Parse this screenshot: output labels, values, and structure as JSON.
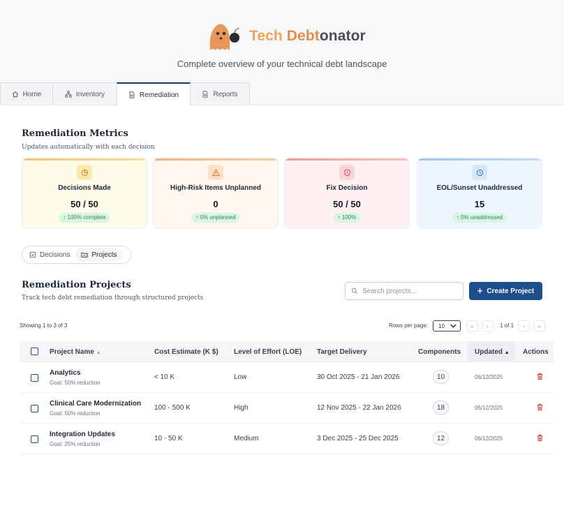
{
  "app": {
    "title_part1": "Tech",
    "title_part2": " Debt",
    "title_part3": "onator",
    "tagline": "Complete overview of your technical debt landscape"
  },
  "tabs": [
    {
      "label": "Home",
      "icon": "home-icon"
    },
    {
      "label": "Inventory",
      "icon": "network-icon"
    },
    {
      "label": "Remediation",
      "icon": "document-icon",
      "active": true
    },
    {
      "label": "Reports",
      "icon": "report-icon"
    }
  ],
  "metrics_section": {
    "title": "Remediation Metrics",
    "subtitle": "Updates automatically with each decision"
  },
  "metrics": [
    {
      "label": "Decisions Made",
      "value": "50 / 50",
      "pill": "↑ 100% complete",
      "icon": "pie-chart-icon",
      "accent": "#f6c56b"
    },
    {
      "label": "High-Risk Items Unplanned",
      "value": "0",
      "pill": "↑ 0% unplanned",
      "icon": "warning-icon",
      "accent": "#f4b27a"
    },
    {
      "label": "Fix Decision",
      "value": "50 / 50",
      "pill": "↑ 100%",
      "icon": "alert-shield-icon",
      "accent": "#f19a9a"
    },
    {
      "label": "EOL/Sunset Unaddressed",
      "value": "15",
      "pill": "↑ 0% unaddressed",
      "icon": "clock-icon",
      "accent": "#9cc3f0"
    }
  ],
  "view_toggle": {
    "decisions": "Decisions",
    "projects": "Projects",
    "selected": "Projects"
  },
  "projects_section": {
    "title": "Remediation Projects",
    "subtitle": "Track tech debt remediation through structured projects",
    "search_placeholder": "Search projects...",
    "create_label": "Create Project"
  },
  "pagination": {
    "showing": "Showing 1 to 3 of 3",
    "rows_label": "Rows per page:",
    "rows_value": "10",
    "page_info": "1 of 1"
  },
  "table": {
    "columns": [
      "Project Name",
      "Cost Estimate (K $)",
      "Level of Effort (LOE)",
      "Target Delivery",
      "Components",
      "Updated",
      "Actions"
    ],
    "rows": [
      {
        "name": "Analytics",
        "goal": "Goal: 50% reduction",
        "cost": "< 10 K",
        "loe": "Low",
        "delivery": "30 Oct 2025 - 21 Jan 2026",
        "components": "10",
        "updated": "06/12/2025"
      },
      {
        "name": "Clinical Care Modernization",
        "goal": "Goal: 50% reduction",
        "cost": "100 - 500 K",
        "loe": "High",
        "delivery": "12 Nov 2025 - 22 Jan 2026",
        "components": "18",
        "updated": "06/12/2025"
      },
      {
        "name": "Integration Updates",
        "goal": "Goal: 25% reduction",
        "cost": "10 - 50 K",
        "loe": "Medium",
        "delivery": "3 Dec 2025 - 25 Dec 2025",
        "components": "12",
        "updated": "06/12/2025"
      }
    ]
  }
}
